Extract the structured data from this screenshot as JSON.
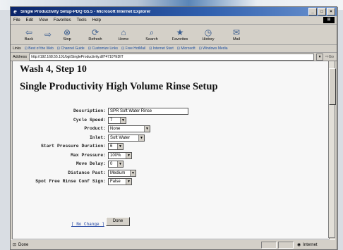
{
  "window": {
    "title": "Single Productivity Setup-PDQ G5.5 - Microsoft Internet Explorer",
    "controls": [
      "_",
      "□",
      "×"
    ]
  },
  "menu": [
    "File",
    "Edit",
    "View",
    "Favorites",
    "Tools",
    "Help"
  ],
  "toolbar": [
    {
      "label": "Back",
      "icon": "back-arrow-icon"
    },
    {
      "label": "",
      "icon": "forward-arrow-icon"
    },
    {
      "label": "Stop",
      "icon": "stop-icon"
    },
    {
      "label": "Refresh",
      "icon": "refresh-icon"
    },
    {
      "label": "Home",
      "icon": "home-icon"
    },
    {
      "label": "Search",
      "icon": "search-icon"
    },
    {
      "label": "Favorites",
      "icon": "favorites-icon"
    },
    {
      "label": "History",
      "icon": "history-icon"
    },
    {
      "label": "Mail",
      "icon": "mail-icon"
    }
  ],
  "links": {
    "label": "Links",
    "items": [
      "Best of the Web",
      "Channel Guide",
      "Customize Links",
      "Free HotMail",
      "Internet Start",
      "Microsoft",
      "Windows Media"
    ]
  },
  "address": {
    "label": "Address",
    "url": "http://192.168.55.101/bgi/SingleProductivity.dll?4710?EDIT",
    "go_label": "Go"
  },
  "page": {
    "heading": "Wash 4, Step 10",
    "subheading": "Single Productivity High Volume Rinse Setup"
  },
  "form": {
    "fields": [
      {
        "label": "Description:",
        "type": "text",
        "value": "SPR Soft Water Rinse"
      },
      {
        "label": "Cycle Speed:",
        "type": "select",
        "value": "7"
      },
      {
        "label": "Product:",
        "type": "select",
        "value": "None"
      },
      {
        "label": "Inlet:",
        "type": "select",
        "value": "Soft Water"
      },
      {
        "label": "Start Pressure Duration:",
        "type": "select",
        "value": "6"
      },
      {
        "label": "Max Pressure:",
        "type": "select",
        "value": "100%"
      },
      {
        "label": "Move Delay:",
        "type": "select",
        "value": "0"
      },
      {
        "label": "Distance Past:",
        "type": "select",
        "value": "Medium"
      },
      {
        "label": "Spot Free Rinse Conf Sign:",
        "type": "select",
        "value": "False"
      }
    ],
    "no_change_link": "[ No Change ]",
    "done_button": "Done"
  },
  "status": {
    "left": "Done",
    "zone": "Internet"
  },
  "colors": {
    "titlebar": "#0a246a",
    "chrome": "#d4d0c8",
    "link": "#1a3fa0"
  }
}
